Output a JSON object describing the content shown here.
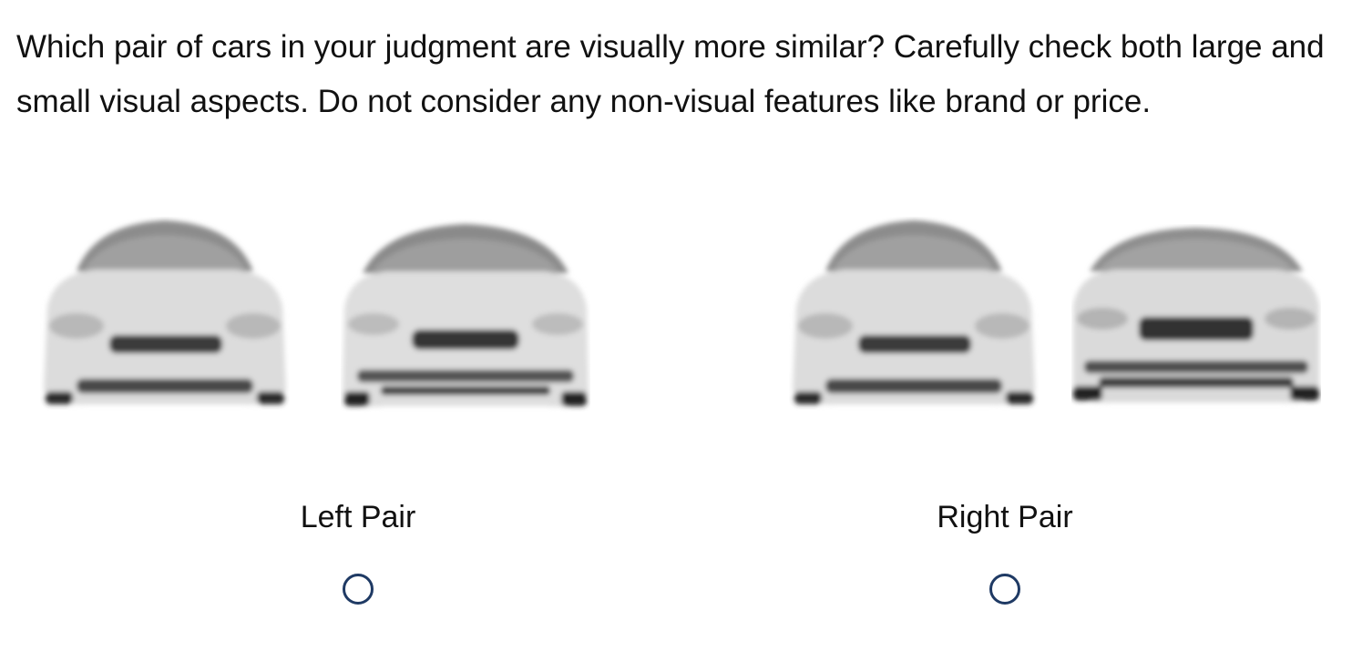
{
  "question": {
    "text": "Which pair of cars in your judgment are visually more similar? Carefully check both large and small visual aspects. Do not consider any non-visual features like brand or price."
  },
  "pairs": [
    {
      "label": "Left Pair",
      "images": [
        "car-front-image",
        "car-front-image"
      ],
      "selected": false
    },
    {
      "label": "Right Pair",
      "images": [
        "car-front-image",
        "car-front-image"
      ],
      "selected": false
    }
  ],
  "colors": {
    "radio_border": "#1f3a64",
    "text": "#111111",
    "background": "#ffffff"
  }
}
